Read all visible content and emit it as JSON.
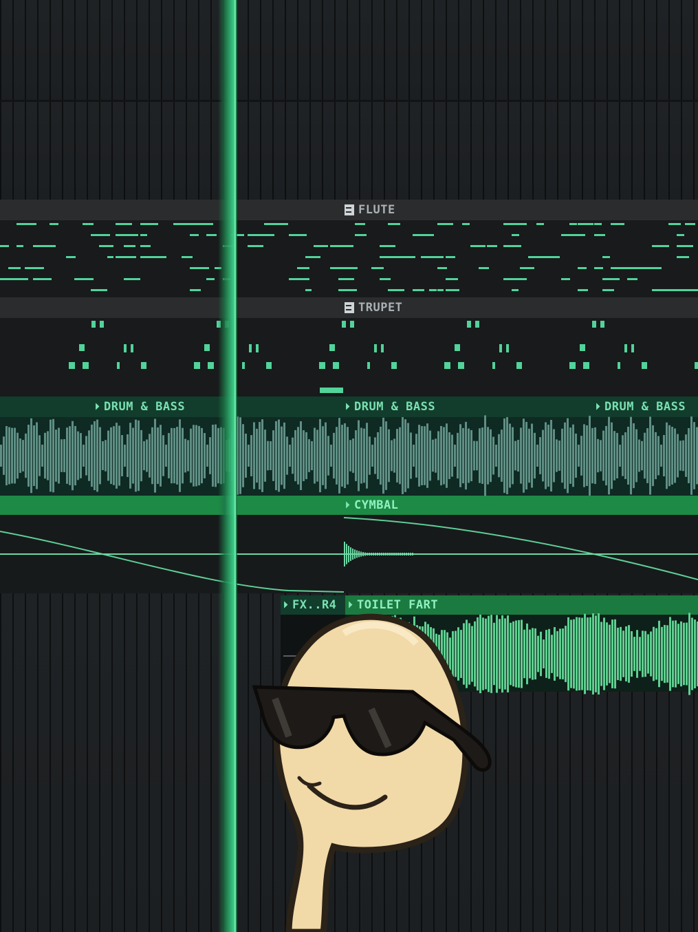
{
  "tracks": {
    "flute": {
      "label": "FLUTE"
    },
    "trupet": {
      "label": "TRUPET"
    },
    "drum_bass": {
      "clips": [
        "DRUM & BASS",
        "DRUM & BASS",
        "DRUM & BASS"
      ]
    },
    "cymbal": {
      "label": "CYMBAL"
    },
    "fx": {
      "label": "FX..R4"
    },
    "toilet_fart": {
      "label": "TOILET FART"
    }
  },
  "colors": {
    "background": "#1b1d1e",
    "accent": "#3cd08a",
    "note": "#52d39a",
    "waveform": "#5f8f85",
    "clip_bar": "#1d8a45"
  },
  "icons": [
    "pattern-icon",
    "audio-clip-arrow-icon"
  ],
  "mascot": "egg-character-with-sunglasses"
}
